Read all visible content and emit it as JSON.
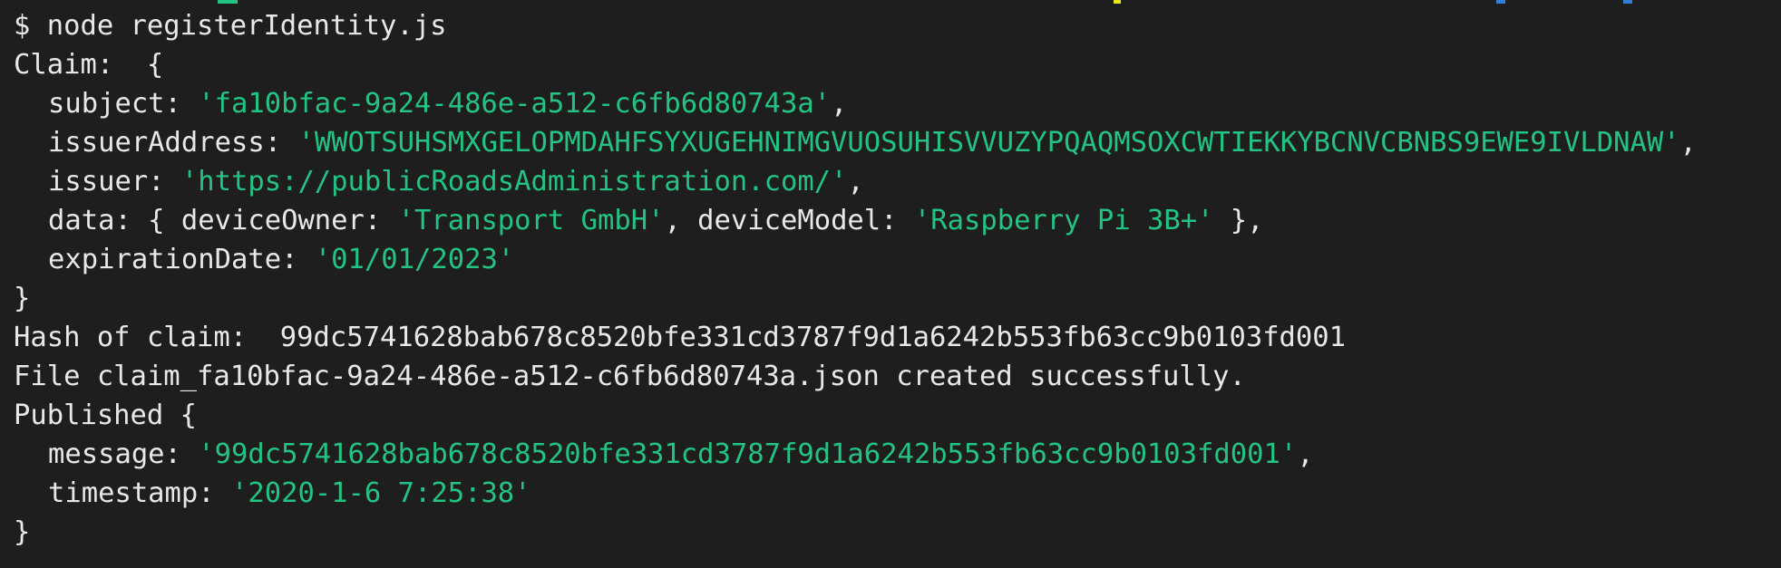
{
  "terminal": {
    "command": "$ node registerIdentity.js",
    "claim_header": "Claim:  {",
    "subject_key": "subject: ",
    "subject_value": "'fa10bfac-9a24-486e-a512-c6fb6d80743a'",
    "issuerAddress_key": "issuerAddress: ",
    "issuerAddress_value": "'WWOTSUHSMXGELOPMDAHFSYXUGEHNIMGVUOSUHISVVUZYPQAQMSOXCWTIEKKYBCNVCBNBS9EWE9IVLDNAW'",
    "issuer_key": "issuer: ",
    "issuer_value": "'https://publicRoadsAdministration.com/'",
    "data_key": "data: { deviceOwner: ",
    "deviceOwner_value": "'Transport GmbH'",
    "deviceModel_key": ", deviceModel: ",
    "deviceModel_value": "'Raspberry Pi 3B+'",
    "data_close": " },",
    "expirationDate_key": "expirationDate: ",
    "expirationDate_value": "'01/01/2023'",
    "brace_close": "}",
    "hash_line": "Hash of claim:  99dc5741628bab678c8520bfe331cd3787f9d1a6242b553fb63cc9b0103fd001",
    "file_line": "File claim_fa10bfac-9a24-486e-a512-c6fb6d80743a.json created successfully.",
    "published_header": "Published {",
    "message_key": "message: ",
    "message_value": "'99dc5741628bab678c8520bfe331cd3787f9d1a6242b553fb63cc9b0103fd001'",
    "timestamp_key": "timestamp: ",
    "timestamp_value": "'2020-1-6 7:25:38'",
    "comma": ","
  },
  "colors": {
    "background": "#1e1e1e",
    "text": "#e8e8e8",
    "string": "#23c483"
  }
}
